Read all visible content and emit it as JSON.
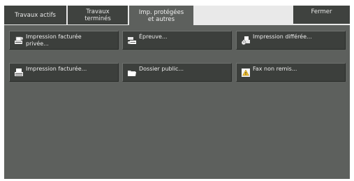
{
  "tabs": [
    {
      "label": "Travaux actifs"
    },
    {
      "label": "Travaux\nterminés"
    },
    {
      "label": "Imp. protégées\net autres"
    }
  ],
  "close_label": "Fermer",
  "buttons": [
    {
      "label": "Impression facturée\nprivée...",
      "icon": "private-print-icon"
    },
    {
      "label": "Épreuve...",
      "icon": "proof-icon"
    },
    {
      "label": "Impression différée...",
      "icon": "delayed-print-icon"
    },
    {
      "label": "Impression facturée...",
      "icon": "billed-print-icon"
    },
    {
      "label": "Dossier public...",
      "icon": "folder-icon"
    },
    {
      "label": "Fax non remis...",
      "icon": "warning-icon"
    }
  ],
  "colors": {
    "panel": "#5d605d",
    "tab": "#3f423f",
    "button": "#3c3f3c",
    "text": "#ececec",
    "warning": "#f2c12e"
  }
}
